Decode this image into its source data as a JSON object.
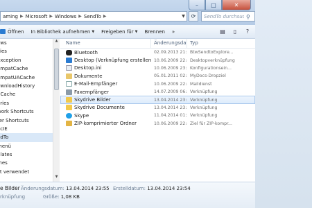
{
  "window": {
    "breadcrumb": [
      "aming",
      "Microsoft",
      "Windows",
      "SendTo"
    ],
    "search_placeholder": "SendTo durchsuchen",
    "controls": {
      "minimize": "–",
      "maximize": "□",
      "close": "✕"
    }
  },
  "toolbar": {
    "open": "Öffnen",
    "library": "In Bibliothek aufnehmen",
    "share": "Freigeben für",
    "burn": "Brennen",
    "more": "»"
  },
  "nav": {
    "items": [
      {
        "label": "ews"
      },
      {
        "label": "kies"
      },
      {
        "label": "Exception"
      },
      {
        "label": "ompatCache"
      },
      {
        "label": "ompatUACache"
      },
      {
        "label": "ownloadHistory"
      },
      {
        "label": "dCache"
      },
      {
        "label": "aries"
      },
      {
        "label": "work Shortcuts"
      },
      {
        "label": "ter Shortcuts"
      },
      {
        "label": "acIE"
      },
      {
        "label": "ndTo",
        "selected": true
      },
      {
        "label": "menü"
      },
      {
        "label": "plates"
      },
      {
        "label": "mes"
      },
      {
        "label": "ct verwendet"
      }
    ]
  },
  "filelist": {
    "columns": {
      "name": "Name",
      "date": "Änderungsdatum",
      "type": "Typ"
    },
    "rows": [
      {
        "name": "Bluetooth",
        "date": "02.09.2013 21:18",
        "type": "BtwSendtoExplore...",
        "icon": "bluetooth-icon"
      },
      {
        "name": "Desktop (Verknüpfung erstellen)",
        "date": "10.06.2009 22:44",
        "type": "Desktopverknüpfung",
        "icon": "desktop-icon"
      },
      {
        "name": "Desktop.ini",
        "date": "10.06.2009 23:55",
        "type": "Konfigurationsein...",
        "icon": "ini-file-icon"
      },
      {
        "name": "Dokumente",
        "date": "05.01.2011 02:22",
        "type": "MyDocs-Dropziel",
        "icon": "documents-icon"
      },
      {
        "name": "E-Mail-Empfänger",
        "date": "10.06.2009 22:44",
        "type": "Maildienst",
        "icon": "mail-icon"
      },
      {
        "name": "Faxempfänger",
        "date": "14.07.2009 06:55",
        "type": "Verknüpfung",
        "icon": "fax-icon"
      },
      {
        "name": "Skydrive Bilder",
        "date": "13.04.2014 23:55",
        "type": "Verknüpfung",
        "icon": "skydrive-icon",
        "selected": true
      },
      {
        "name": "Skydrive Documente",
        "date": "13.04.2014 23:59",
        "type": "Verknüpfung",
        "icon": "skydrive-icon"
      },
      {
        "name": "Skype",
        "date": "11.04.2014 01:27",
        "type": "Verknüpfung",
        "icon": "skype-icon"
      },
      {
        "name": "ZIP-komprimierter Ordner",
        "date": "10.06.2009 22:45",
        "type": "Ziel für ZIP-kompr...",
        "icon": "zip-icon"
      }
    ]
  },
  "details": {
    "filename": "e Bilder",
    "modified_label": "Änderungsdatum:",
    "modified_value": "13.04.2014 23:55",
    "created_label": "Erstelldatum:",
    "created_value": "13.04.2014 23:54",
    "kind": "rknüpfung",
    "size_label": "Größe:",
    "size_value": "1,08 KB"
  }
}
